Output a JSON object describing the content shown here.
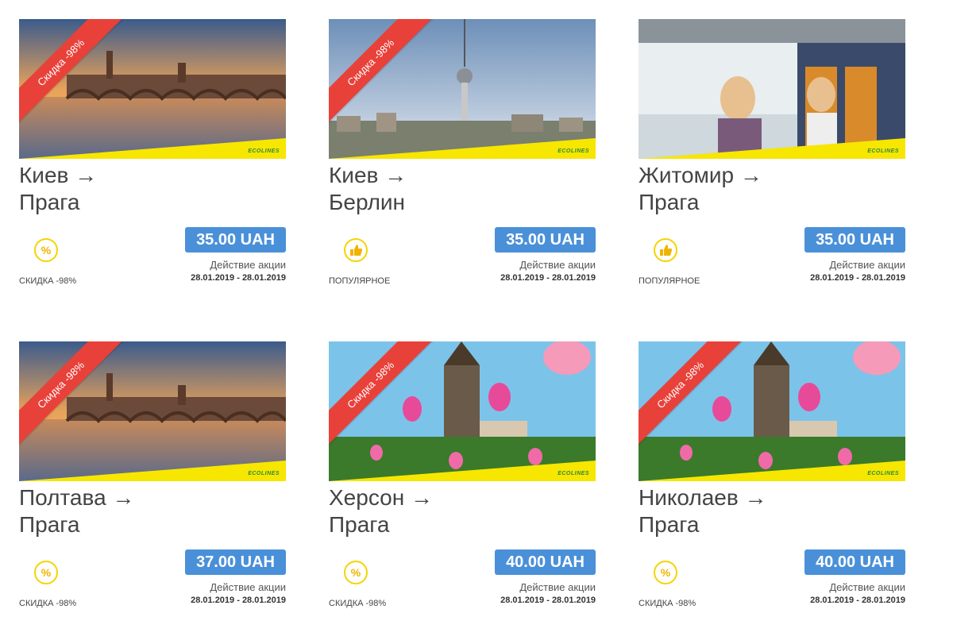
{
  "colors": {
    "ribbon": "#e8413a",
    "price_bg": "#4a90d9",
    "icon_yellow": "#f5d400",
    "brand_yellow": "#f7e600"
  },
  "cards": [
    {
      "ribbon": "Скидка -98%",
      "brand": "ECOLINES",
      "from": "Киев →",
      "to": "Прага",
      "badge_icon": "percent-icon",
      "badge_label": "СКИДКА -98%",
      "price": "35.00 UAH",
      "valid_label": "Действие акции",
      "valid_dates": "28.01.2019 - 28.01.2019",
      "image": "prague-bridge-sunset"
    },
    {
      "ribbon": "Скидка -98%",
      "brand": "ECOLINES",
      "from": "Киев →",
      "to": "Берлин",
      "badge_icon": "thumbs-up-icon",
      "badge_label": "ПОПУЛЯРНОЕ",
      "price": "35.00 UAH",
      "valid_label": "Действие акции",
      "valid_dates": "28.01.2019 - 28.01.2019",
      "image": "berlin-tv-tower"
    },
    {
      "ribbon": "",
      "brand": "ECOLINES",
      "from": "Житомир →",
      "to": "Прага",
      "badge_icon": "thumbs-up-icon",
      "badge_label": "ПОПУЛЯРНОЕ",
      "price": "35.00 UAH",
      "valid_label": "Действие акции",
      "valid_dates": "28.01.2019 - 28.01.2019",
      "image": "bus-passengers"
    },
    {
      "ribbon": "Скидка -98%",
      "brand": "ECOLINES",
      "from": "Полтава →",
      "to": "Прага",
      "badge_icon": "percent-icon",
      "badge_label": "СКИДКА -98%",
      "price": "37.00 UAH",
      "valid_label": "Действие акции",
      "valid_dates": "28.01.2019 - 28.01.2019",
      "image": "prague-bridge-sunset"
    },
    {
      "ribbon": "Скидка -98%",
      "brand": "ECOLINES",
      "from": "Херсон →",
      "to": "Прага",
      "badge_icon": "percent-icon",
      "badge_label": "СКИДКА -98%",
      "price": "40.00 UAH",
      "valid_label": "Действие акции",
      "valid_dates": "28.01.2019 - 28.01.2019",
      "image": "prague-tulips"
    },
    {
      "ribbon": "Скидка -98%",
      "brand": "ECOLINES",
      "from": "Николаев →",
      "to": "Прага",
      "badge_icon": "percent-icon",
      "badge_label": "СКИДКА -98%",
      "price": "40.00 UAH",
      "valid_label": "Действие акции",
      "valid_dates": "28.01.2019 - 28.01.2019",
      "image": "prague-tulips"
    }
  ]
}
